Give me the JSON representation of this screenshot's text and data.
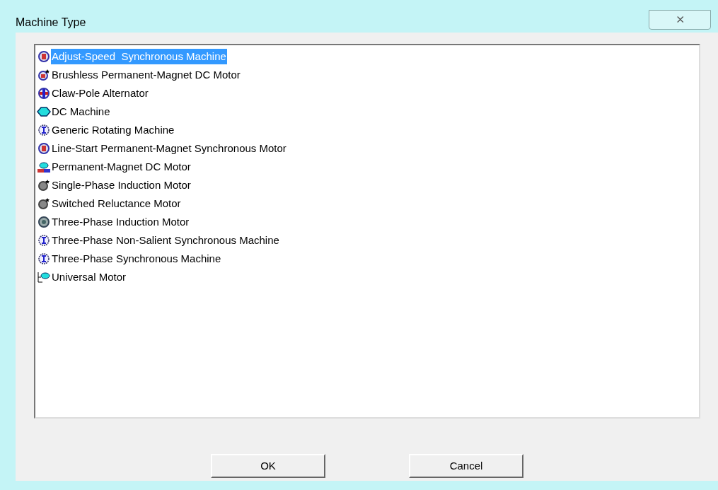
{
  "window": {
    "title": "Machine Type",
    "close": "⨯"
  },
  "list": {
    "items": [
      {
        "label": "Adjust-Speed  Synchronous Machine",
        "kind": "synchronous",
        "selected": true
      },
      {
        "label": "Brushless Permanent-Magnet DC Motor",
        "kind": "brushless",
        "selected": false
      },
      {
        "label": "Claw-Pole Alternator",
        "kind": "claw",
        "selected": false
      },
      {
        "label": "DC Machine",
        "kind": "dc",
        "selected": false
      },
      {
        "label": "Generic Rotating Machine",
        "kind": "generic",
        "selected": false
      },
      {
        "label": "Line-Start Permanent-Magnet Synchronous Motor",
        "kind": "synchronous",
        "selected": false
      },
      {
        "label": "Permanent-Magnet DC Motor",
        "kind": "pmdc",
        "selected": false
      },
      {
        "label": "Single-Phase Induction Motor",
        "kind": "brushless-grey",
        "selected": false
      },
      {
        "label": "Switched Reluctance Motor",
        "kind": "brushless-grey",
        "selected": false
      },
      {
        "label": "Three-Phase Induction Motor",
        "kind": "induction",
        "selected": false
      },
      {
        "label": "Three-Phase Non-Salient Synchronous Machine",
        "kind": "generic",
        "selected": false
      },
      {
        "label": "Three-Phase Synchronous Machine",
        "kind": "generic",
        "selected": false
      },
      {
        "label": "Universal Motor",
        "kind": "universal",
        "selected": false
      }
    ]
  },
  "buttons": [
    "OK",
    "Cancel"
  ]
}
